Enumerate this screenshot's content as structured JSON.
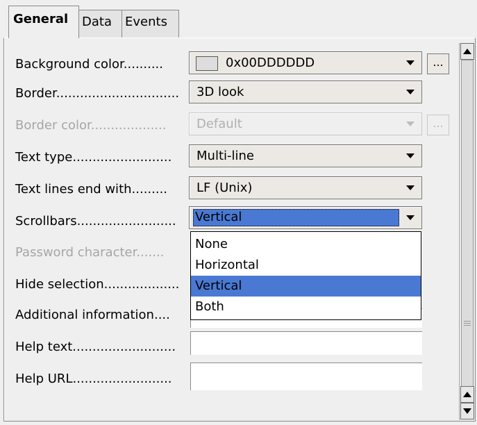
{
  "tabs": [
    {
      "label": "General"
    },
    {
      "label": "Data"
    },
    {
      "label": "Events"
    }
  ],
  "properties": {
    "background_color": {
      "label": "Background color..........",
      "value": "0x00DDDDDD",
      "swatch": "#dddddd"
    },
    "border": {
      "label": "Border...............................",
      "value": "3D look"
    },
    "border_color": {
      "label": "Border color...................",
      "value": "Default"
    },
    "text_type": {
      "label": "Text type.........................",
      "value": "Multi-line"
    },
    "text_lines_end": {
      "label": "Text lines end with.........",
      "value": "LF (Unix)"
    },
    "scrollbars": {
      "label": "Scrollbars.........................",
      "value": "Vertical"
    },
    "password_character": {
      "label": "Password character......."
    },
    "hide_selection": {
      "label": "Hide selection..................."
    },
    "additional_information": {
      "label": "Additional information...."
    },
    "help_text": {
      "label": "Help text.........................."
    },
    "help_url": {
      "label": "Help URL........................."
    }
  },
  "dots_label": "...",
  "scrollbar_options": [
    "None",
    "Horizontal",
    "Vertical",
    "Both"
  ],
  "selected_option": "Vertical",
  "colors": {
    "selection": "#4a79d3"
  }
}
